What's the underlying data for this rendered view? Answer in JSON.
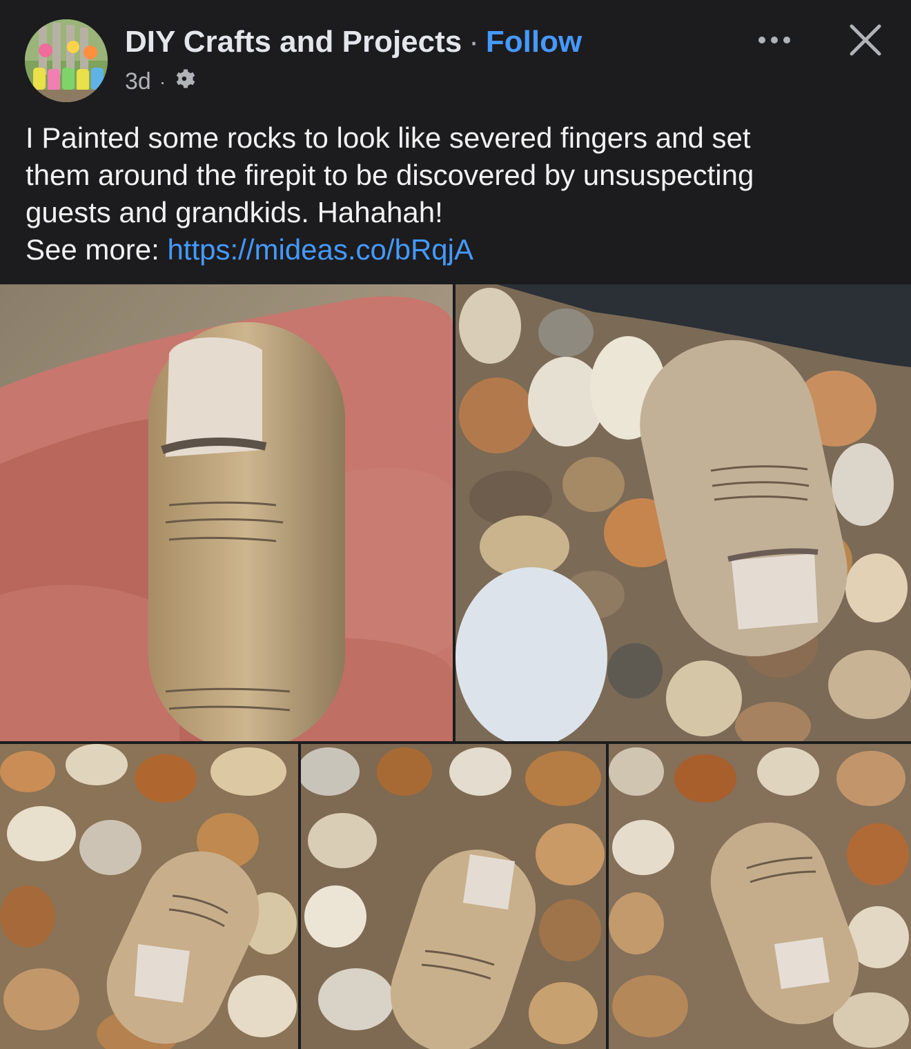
{
  "post": {
    "author": "DIY Crafts and Projects",
    "separator": "·",
    "follow_label": "Follow",
    "timestamp": "3d",
    "meta_dot": "·",
    "audience_icon": "gear-icon",
    "caption_lines": [
      "I Painted some rocks to look like severed fingers and set",
      "them around the firepit to be discovered by unsuspecting",
      "guests and grandkids.  Hahahah!"
    ],
    "see_more_label": "See more: ",
    "link": "https://mideas.co/bRqjA"
  },
  "icons": {
    "more": "more-options-icon",
    "close": "close-icon"
  },
  "colors": {
    "background": "#1c1c1e",
    "link": "#4599ff",
    "text": "#e4e6eb",
    "muted": "#b0b3b8"
  }
}
